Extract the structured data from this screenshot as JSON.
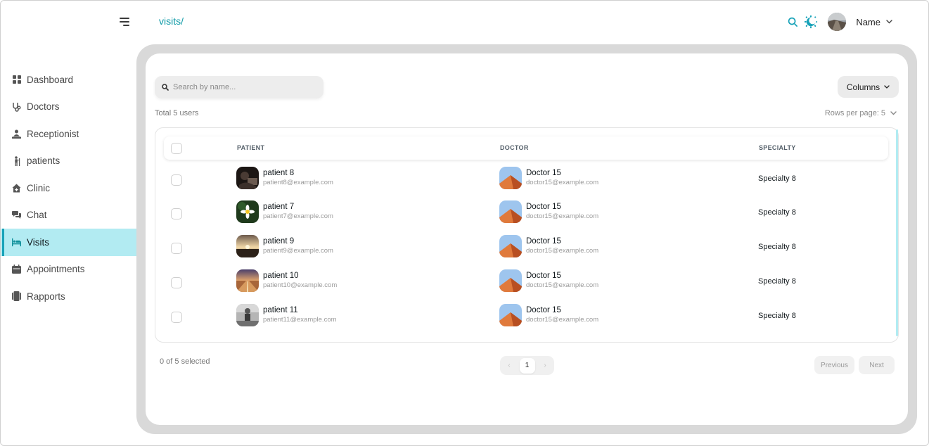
{
  "header": {
    "breadcrumb": "visits/",
    "user_name": "Name"
  },
  "sidebar": {
    "items": [
      {
        "label": "Dashboard",
        "icon": "dashboard-icon"
      },
      {
        "label": "Doctors",
        "icon": "stethoscope-icon"
      },
      {
        "label": "Receptionist",
        "icon": "receptionist-icon"
      },
      {
        "label": "patients",
        "icon": "patient-icon"
      },
      {
        "label": "Clinic",
        "icon": "clinic-icon"
      },
      {
        "label": "Chat",
        "icon": "chat-icon"
      },
      {
        "label": "Visits",
        "icon": "bed-icon",
        "active": true
      },
      {
        "label": "Appointments",
        "icon": "calendar-icon"
      },
      {
        "label": "Rapports",
        "icon": "report-icon"
      }
    ]
  },
  "toolbar": {
    "search_placeholder": "Search by name...",
    "search_value": "",
    "columns_label": "Columns",
    "total_text": "Total 5 users",
    "rows_per_page_label": "Rows per page:",
    "rows_per_page_value": "5"
  },
  "table": {
    "headers": {
      "patient": "PATIENT",
      "doctor": "DOCTOR",
      "specialty": "SPECIALTY"
    },
    "rows": [
      {
        "patient_name": "patient 8",
        "patient_email": "patient8@example.com",
        "patient_avatar": "photo-dark",
        "doctor_name": "Doctor 15",
        "doctor_email": "doctor15@example.com",
        "specialty": "Specialty 8"
      },
      {
        "patient_name": "patient 7",
        "patient_email": "patient7@example.com",
        "patient_avatar": "photo-flower",
        "doctor_name": "Doctor 15",
        "doctor_email": "doctor15@example.com",
        "specialty": "Specialty 8"
      },
      {
        "patient_name": "patient 9",
        "patient_email": "patient9@example.com",
        "patient_avatar": "photo-sunset",
        "doctor_name": "Doctor 15",
        "doctor_email": "doctor15@example.com",
        "specialty": "Specialty 8"
      },
      {
        "patient_name": "patient 10",
        "patient_email": "patient10@example.com",
        "patient_avatar": "photo-road",
        "doctor_name": "Doctor 15",
        "doctor_email": "doctor15@example.com",
        "specialty": "Specialty 8"
      },
      {
        "patient_name": "patient 11",
        "patient_email": "patient11@example.com",
        "patient_avatar": "photo-grey",
        "doctor_name": "Doctor 15",
        "doctor_email": "doctor15@example.com",
        "specialty": "Specialty 8"
      }
    ]
  },
  "footer": {
    "selected_text": "0 of 5 selected",
    "current_page": "1",
    "prev_label": "Previous",
    "next_label": "Next"
  },
  "colors": {
    "accent": "#17a2b8",
    "active_bg": "#b2ebf2",
    "breadcrumb": "#0e9aa7"
  }
}
